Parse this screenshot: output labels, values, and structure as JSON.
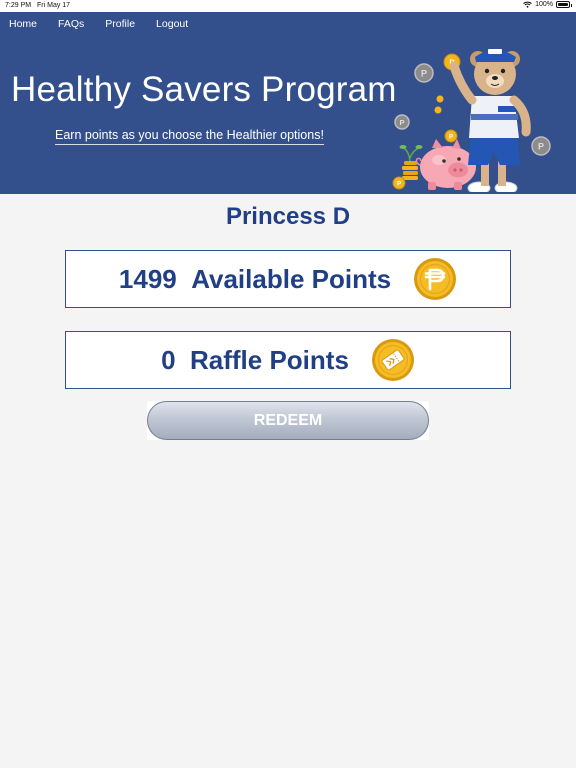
{
  "status_bar": {
    "time": "7:29 PM",
    "date": "Fri May 17",
    "battery": "100%"
  },
  "nav": {
    "home": "Home",
    "faqs": "FAQs",
    "profile": "Profile",
    "logout": "Logout"
  },
  "banner": {
    "title": "Healthy Savers Program",
    "subtitle": "Earn points as you choose the Healthier options!",
    "coin_letter": "P"
  },
  "user": {
    "name": "Princess D"
  },
  "points": {
    "available": {
      "value": "1499",
      "label": "Available Points",
      "icon": "peso-coin-icon"
    },
    "raffle": {
      "value": "0",
      "label": "Raffle Points",
      "icon": "raffle-coin-icon"
    }
  },
  "actions": {
    "redeem_label": "REDEEM"
  },
  "colors": {
    "banner": "#33508c",
    "text_primary": "#213f85",
    "background": "#f4f4f4",
    "coin_gold": "#f2b61c"
  }
}
